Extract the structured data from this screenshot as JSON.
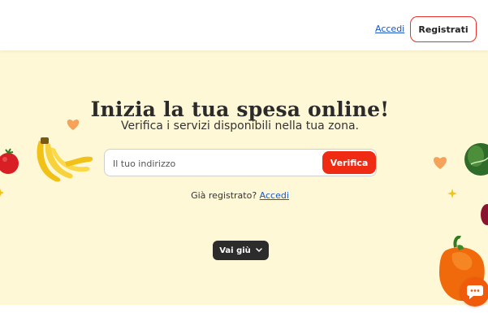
{
  "header": {
    "login_label": "Accedi",
    "register_label": "Registrati"
  },
  "hero": {
    "title": "Inizia la tua spesa online!",
    "subtitle": "Verifica i servizi disponibili nella tua zona.",
    "search": {
      "placeholder": "Il tuo indirizzo",
      "button_label": "Verifica"
    },
    "already_registered": {
      "text": "Già registrato?",
      "link_label": "Accedi"
    },
    "scroll_button_label": "Vai giù"
  },
  "colors": {
    "hero_background": "#fff8d6",
    "accent_red": "#ef2b14",
    "link_blue": "#1a56c8",
    "chat_orange": "#f05a0a"
  },
  "icons": {
    "scroll": "chevron-down-icon",
    "chat": "chat-bubble-icon",
    "decorations": [
      "tomato-icon",
      "banana-icon",
      "heart-icon",
      "leafy-greens-icon",
      "pepper-icon",
      "sparkle-icon"
    ]
  }
}
